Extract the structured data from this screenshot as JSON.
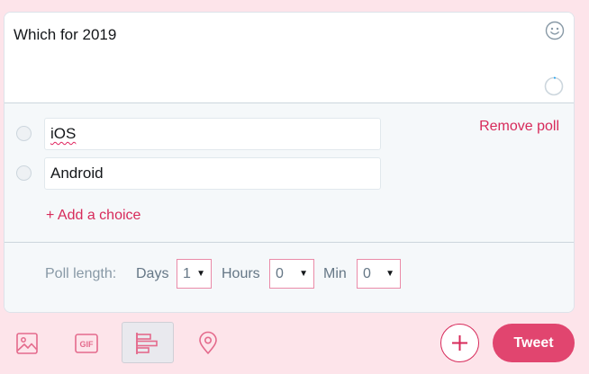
{
  "composer": {
    "tweet_text": "Which for 2019"
  },
  "poll": {
    "choices": [
      {
        "value": "iOS"
      },
      {
        "value": "Android"
      }
    ],
    "remove_label": "Remove poll",
    "add_choice_label": "+ Add a choice",
    "length": {
      "label": "Poll length:",
      "days_label": "Days",
      "days_value": "1",
      "hours_label": "Hours",
      "hours_value": "0",
      "min_label": "Min",
      "min_value": "0"
    }
  },
  "toolbar": {
    "icons": [
      "image-icon",
      "gif-icon",
      "poll-icon",
      "location-icon"
    ],
    "add_tweet_icon": "plus-icon",
    "tweet_label": "Tweet"
  },
  "colors": {
    "accent": "#e1456f",
    "accent_text": "#d72a5a",
    "page_bg": "#fde4ea",
    "poll_bg": "#f5f8fa",
    "muted": "#8899a6"
  }
}
